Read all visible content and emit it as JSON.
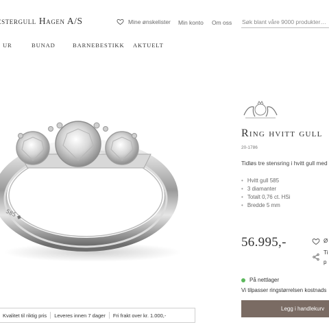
{
  "header": {
    "brand": "estergull Hagen A/S",
    "wishlist_label": "Mine ønskelister",
    "account_label": "Min konto",
    "about_label": "Om oss",
    "search_placeholder": "Søk blant våre 9000 produkter…"
  },
  "nav": {
    "items": [
      {
        "label": "UR"
      },
      {
        "label": "BUNAD"
      },
      {
        "label": "BARNEBESTIKK"
      },
      {
        "label": "AKTUELT"
      }
    ]
  },
  "usp_bar": {
    "items": [
      "Kvalitet til riktig pris",
      "Leveres innen 7 dager",
      "Fri frakt over kr. 1.000,-"
    ]
  },
  "product": {
    "title": "Ring hvitt gull",
    "sku": "20-1786",
    "description": "Tidløs tre stensring i hvitt gull med d",
    "specs": [
      "Hvitt gull 585",
      "3 diamanter",
      "Totalt 0,76 ct. HSi",
      "Bredde 5 mm"
    ],
    "price": "56.995,-",
    "wishlist_short": "Ø",
    "share_line1": "Ti",
    "share_line2": "p",
    "stock_status": "På nettlager",
    "resize_note": "Vi tilpasser ringstørrelsen kostnads",
    "add_to_cart_label": "Legg i handlekurv",
    "stock_color": "#5cb85c",
    "cart_button_color": "#7a6b63"
  },
  "icons": [
    "heart-icon",
    "share-icon",
    "brand-crest-icon"
  ]
}
